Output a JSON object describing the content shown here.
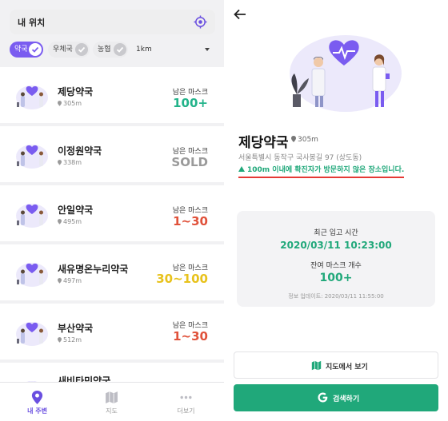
{
  "left": {
    "search_label": "내 위치",
    "filters": {
      "chips": [
        {
          "label": "약국",
          "active": true
        },
        {
          "label": "우체국",
          "active": false
        },
        {
          "label": "농협",
          "active": false
        }
      ],
      "distance": "1km"
    },
    "stores": [
      {
        "name": "제당약국",
        "distance": "305m",
        "mask_label": "남은 마스크",
        "mask_value": "100+",
        "color": "#22b38a"
      },
      {
        "name": "이정원약국",
        "distance": "338m",
        "mask_label": "남은 마스크",
        "mask_value": "SOLD",
        "color": "#9a9a9a"
      },
      {
        "name": "안일약국",
        "distance": "495m",
        "mask_label": "남은 마스크",
        "mask_value": "1~30",
        "color": "#e0523b"
      },
      {
        "name": "새유명온누리약국",
        "distance": "497m",
        "mask_label": "남은 마스크",
        "mask_value": "30~100",
        "color": "#e8c21c"
      },
      {
        "name": "부산약국",
        "distance": "512m",
        "mask_label": "남은 마스크",
        "mask_value": "1~30",
        "color": "#e0523b"
      },
      {
        "name": "새비타민약국",
        "distance": "",
        "mask_label": "",
        "mask_value": "",
        "color": "#9a9a9a"
      }
    ],
    "nav": [
      {
        "label": "내 주변",
        "icon": "location-pin-icon",
        "active": true
      },
      {
        "label": "지도",
        "icon": "map-icon",
        "active": false
      },
      {
        "label": "더보기",
        "icon": "more-icon",
        "active": false
      }
    ]
  },
  "detail": {
    "name": "제당약국",
    "distance": "305m",
    "address": "서울특별시 동작구 국사봉길 97 (상도동)",
    "warning": "100m 이내에 확진자가 방문하지 않은 장소입니다.",
    "stock_time_label": "최근 입고 시간",
    "stock_time": "2020/03/11 10:23:00",
    "remaining_label": "잔여 마스크 개수",
    "remaining": "100+",
    "updated": "정보 업데이트: 2020/03/11 11:55:00",
    "map_button": "지도에서 보기",
    "search_button": "검색하기"
  },
  "colors": {
    "accent": "#7a5cf0",
    "green": "#20a87a",
    "warning_underline": "#e53935"
  }
}
